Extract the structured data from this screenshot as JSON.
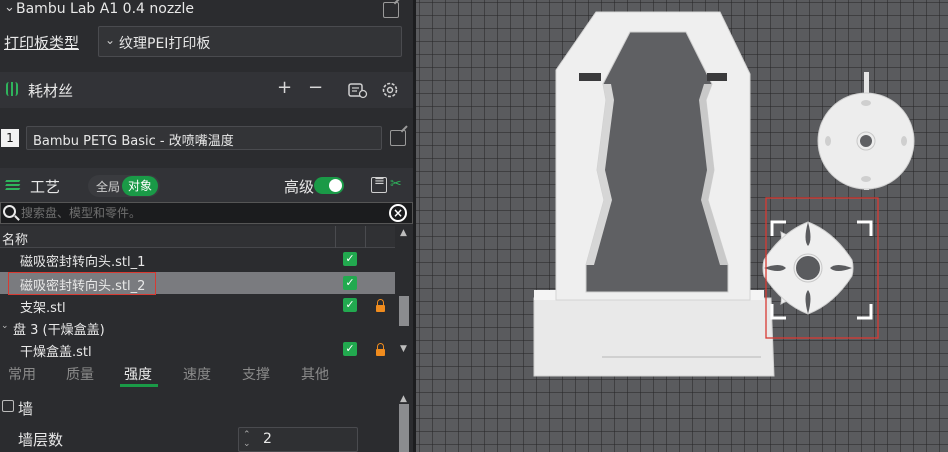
{
  "printer": {
    "name": "Bambu Lab A1 0.4 nozzle"
  },
  "plate": {
    "label": "打印板类型",
    "value": "纹理PEI打印板"
  },
  "filament": {
    "title": "耗材丝",
    "add": "+",
    "remove": "−",
    "index": "1",
    "name": "Bambu PETG Basic - 改喷嘴温度"
  },
  "process": {
    "title": "工艺",
    "global_label": "全局",
    "object_label": "对象",
    "advanced_label": "高级"
  },
  "search": {
    "placeholder": "搜索盘、模型和零件。"
  },
  "object_list": {
    "column_name": "名称",
    "rows": [
      {
        "label": "磁吸密封转向头.stl_1",
        "checked": true,
        "locked": false
      },
      {
        "label": "磁吸密封转向头.stl_2",
        "checked": true,
        "locked": false,
        "selected": true
      },
      {
        "label": "支架.stl",
        "checked": true,
        "locked": true
      },
      {
        "label": "盘 3 (干燥盒盖)",
        "group": true
      },
      {
        "label": "干燥盒盖.stl",
        "checked": true,
        "locked": true
      }
    ]
  },
  "tabs": [
    "常用",
    "质量",
    "强度",
    "速度",
    "支撑",
    "其他"
  ],
  "active_tab": "强度",
  "wall": {
    "title": "墙",
    "layers_label": "墙层数",
    "layers_value": "2"
  },
  "colors": {
    "accent": "#1a9a47",
    "selection": "#d83a32",
    "lock": "#f08c1e"
  }
}
